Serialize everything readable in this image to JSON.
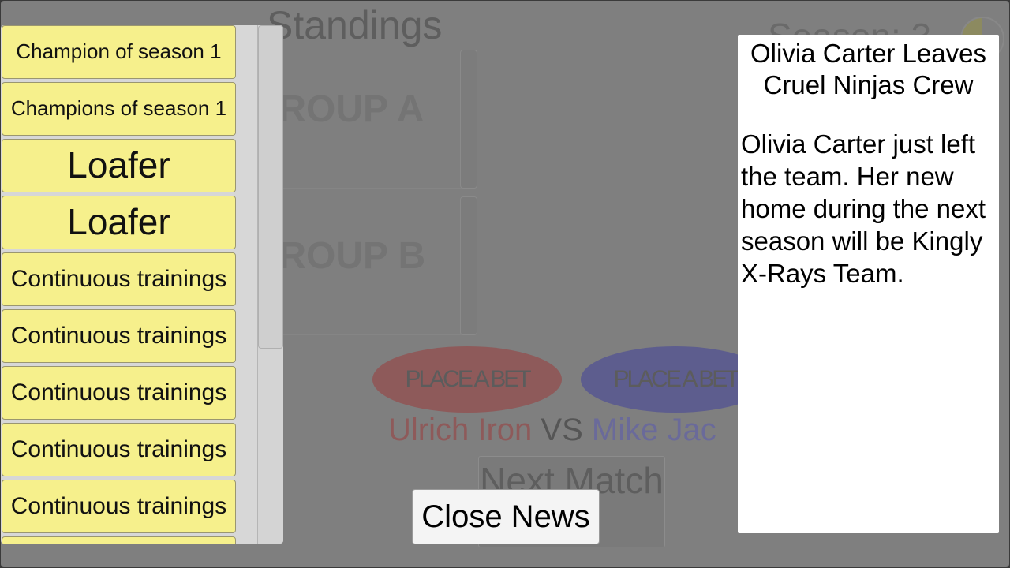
{
  "background": {
    "title": "Standings",
    "season_label": "Season: 3",
    "groups": [
      "GROUP A",
      "GROUP B"
    ],
    "bet_buttons": [
      {
        "label": "PLACE A BET",
        "color": "#8e5a5a"
      },
      {
        "label": "PLACE A BET",
        "color": "#5d5d8e"
      }
    ],
    "match": {
      "home": "Ulrich Iron",
      "vs": "VS",
      "away": "Mike Jac",
      "home_color": "#8e5a5a",
      "away_color": "#6a6a9a"
    },
    "next_match_label": "Next Match"
  },
  "news_list": {
    "items": [
      "Champion of season 1",
      "Champions of season 1",
      "Loafer",
      "Loafer",
      "Continuous trainings",
      "Continuous trainings",
      "Continuous trainings",
      "Continuous trainings",
      "Continuous trainings",
      ""
    ]
  },
  "news_article": {
    "title": "Olivia Carter Leaves Cruel Ninjas Crew",
    "body": "Olivia Carter just left the team. Her new home during the next season will be Kingly X-Rays Team."
  },
  "close_button_label": "Close News",
  "colors": {
    "item_bg": "#f6f08c",
    "overlay": "#7f7f7f"
  }
}
